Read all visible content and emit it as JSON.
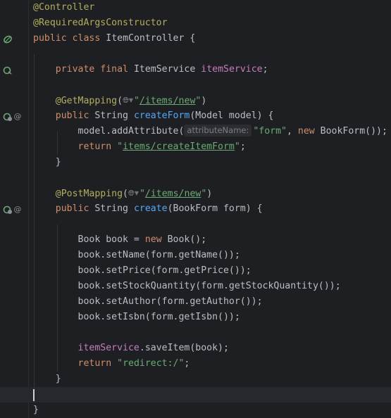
{
  "icons": {
    "gutter_bean": "spring-bean-icon",
    "gutter_injected": "injected-dependency-icon",
    "gutter_endpoint": "web-endpoint-icon",
    "gutter_annotation": "at-sign-icon",
    "url_globe": "globe-icon",
    "url_chevron": "chevron-down-icon"
  },
  "colors": {
    "background": "#1e1f22",
    "keyword": "#cf8e6d",
    "annotation": "#b3ae60",
    "string": "#6aab73",
    "method": "#56a8f5",
    "field": "#c77dbb",
    "text": "#bcbec4"
  },
  "code": {
    "l1": {
      "ann": "@Controller"
    },
    "l2": {
      "ann": "@RequiredArgsConstructor"
    },
    "l3": {
      "kw1": "public",
      "kw2": "class",
      "name": "ItemController",
      "brace": " {"
    },
    "l5": {
      "kw1": "private",
      "kw2": "final",
      "type": "ItemService",
      "field": "itemService",
      "end": ";"
    },
    "l7": {
      "ann": "@GetMapping",
      "open": "(",
      "q1": "\"",
      "url": "/items/new",
      "q2": "\"",
      "close": ")"
    },
    "l8": {
      "kw1": "public",
      "type": "String",
      "method": "createForm",
      "params": "(Model model) {"
    },
    "l9": {
      "pre": "model.addAttribute(",
      "hint": "attributeName:",
      "str": "\"form\"",
      "mid": ", ",
      "kw": "new",
      "post": " BookForm());"
    },
    "l10": {
      "kw": "return",
      "q1": "\"",
      "url": "items/createItemForm",
      "q2": "\"",
      "end": ";"
    },
    "l11": {
      "brace": "}"
    },
    "l13": {
      "ann": "@PostMapping",
      "open": "(",
      "q1": "\"",
      "url": "/items/new",
      "q2": "\"",
      "close": ")"
    },
    "l14": {
      "kw1": "public",
      "type": "String",
      "method": "create",
      "params": "(BookForm form) {"
    },
    "l16": {
      "pre": "Book book = ",
      "kw": "new",
      "post": " Book();"
    },
    "l17": {
      "text": "book.setName(form.getName());"
    },
    "l18": {
      "text": "book.setPrice(form.getPrice());"
    },
    "l19": {
      "text": "book.setStockQuantity(form.getStockQuantity());"
    },
    "l20": {
      "text": "book.setAuthor(form.getAuthor());"
    },
    "l21": {
      "text": "book.setIsbn(form.getIsbn());"
    },
    "l23": {
      "field": "itemService",
      "post": ".saveItem(book);"
    },
    "l24": {
      "kw": "return",
      "str": "\"redirect:/\"",
      "end": ";"
    },
    "l25": {
      "brace": "}"
    },
    "l27": {
      "brace": "}"
    }
  }
}
